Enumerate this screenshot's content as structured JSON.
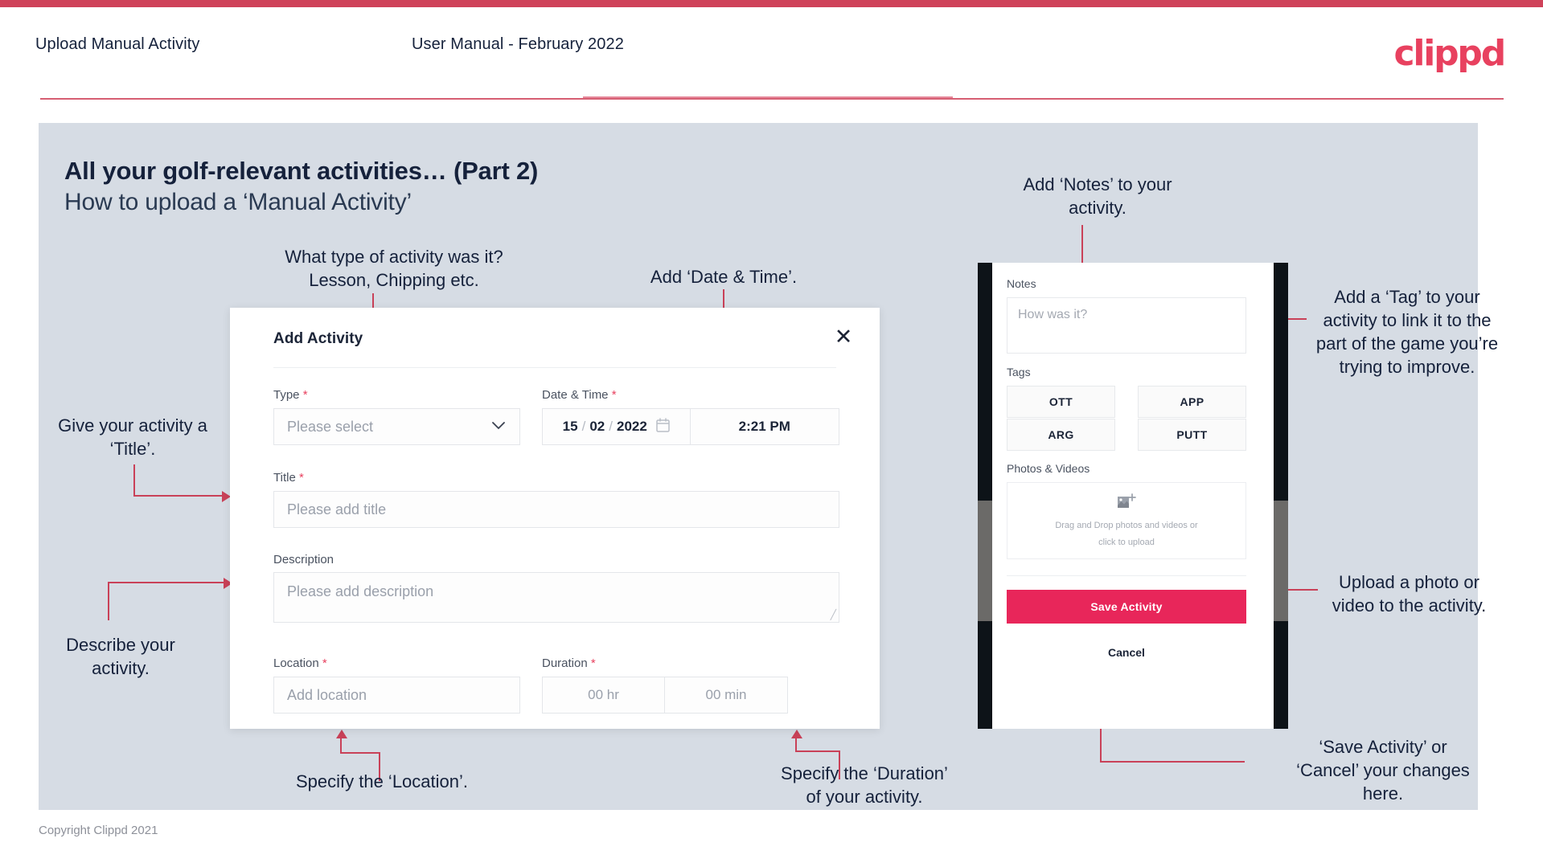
{
  "header": {
    "title": "Upload Manual Activity",
    "subtitle": "User Manual - February 2022",
    "logo": "clippd"
  },
  "slide": {
    "heading": "All your golf-relevant activities… (Part 2)",
    "subheading": "How to upload a ‘Manual Activity’",
    "copyright": "Copyright Clippd 2021"
  },
  "annotations": {
    "type": "What type of activity was it?\nLesson, Chipping etc.",
    "type_line1": "What type of activity was it?",
    "type_line2": "Lesson, Chipping etc.",
    "datetime": "Add ‘Date & Time’.",
    "title": "Give your activity a\n‘Title’.",
    "title_line1": "Give your activity a",
    "title_line2": "‘Title’.",
    "description_line1": "Describe your",
    "description_line2": "activity.",
    "location": "Specify the ‘Location’.",
    "duration_line1": "Specify the ‘Duration’",
    "duration_line2": "of your activity.",
    "notes_line1": "Add ‘Notes’ to your",
    "notes_line2": "activity.",
    "tags": "Add a ‘Tag’ to your activity to link it to the part of the game you’re trying to improve.",
    "upload_line1": "Upload a photo or",
    "upload_line2": "video to the activity.",
    "save_line1": "‘Save Activity’ or",
    "save_line2": "‘Cancel’ your changes",
    "save_line3": "here."
  },
  "dialog": {
    "title": "Add Activity",
    "close": "✕",
    "fields": {
      "type": {
        "label": "Type",
        "required": true,
        "placeholder": "Please select"
      },
      "datetime": {
        "label": "Date & Time",
        "required": true,
        "day": "15",
        "month": "02",
        "year": "2022",
        "sep": "/",
        "time": "2:21 PM"
      },
      "title": {
        "label": "Title",
        "required": true,
        "placeholder": "Please add title"
      },
      "description": {
        "label": "Description",
        "required": false,
        "placeholder": "Please add description"
      },
      "location": {
        "label": "Location",
        "required": true,
        "placeholder": "Add location"
      },
      "duration": {
        "label": "Duration",
        "required": true,
        "hours": "00 hr",
        "minutes": "00 min"
      }
    }
  },
  "phone": {
    "notes": {
      "label": "Notes",
      "placeholder": "How was it?"
    },
    "tags": {
      "label": "Tags",
      "items": [
        "OTT",
        "APP",
        "ARG",
        "PUTT"
      ]
    },
    "photos": {
      "label": "Photos & Videos",
      "drop_line1": "Drag and Drop photos and videos or",
      "drop_line2": "click to upload"
    },
    "save_label": "Save Activity",
    "cancel_label": "Cancel"
  },
  "colors": {
    "accent": "#e8415f",
    "accent_button": "#e8265a",
    "connector": "#c94158",
    "slide_bg": "#d6dce4",
    "text_dark": "#15213b"
  }
}
